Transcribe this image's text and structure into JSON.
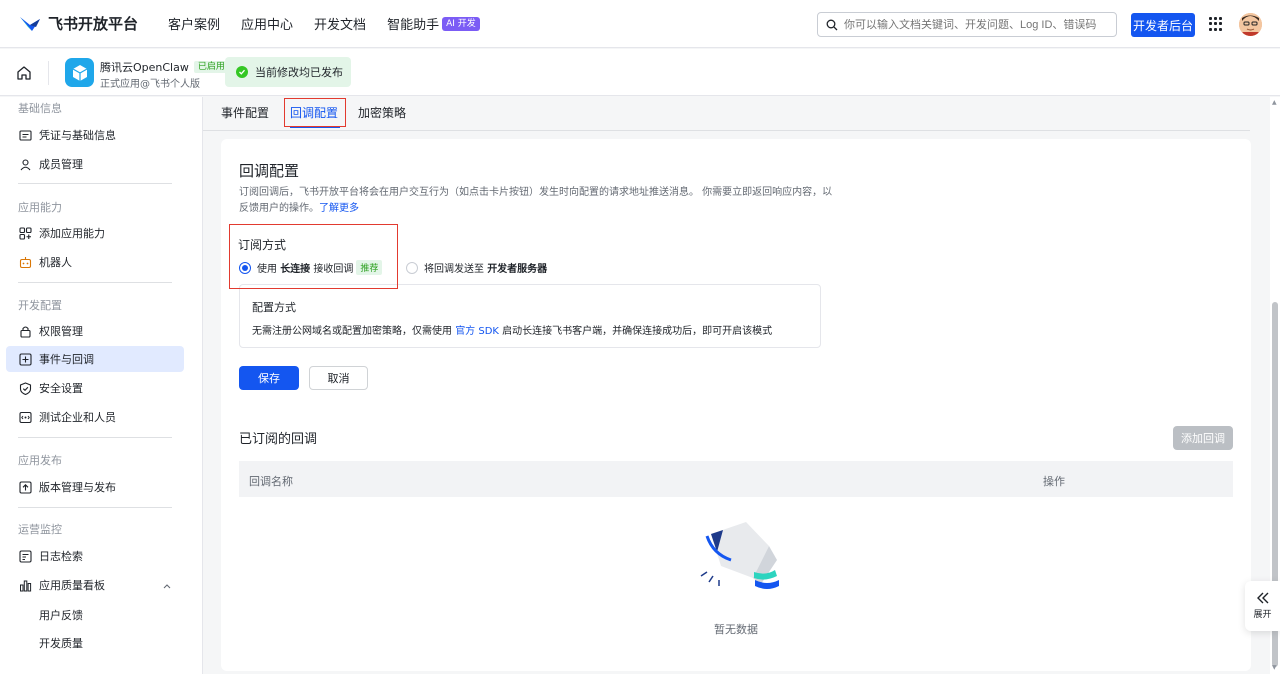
{
  "topnav": {
    "logo_text": "飞书开放平台",
    "links": [
      "客户案例",
      "应用中心",
      "开发文档",
      "智能助手"
    ],
    "ai_badge": "AI 开发",
    "search_placeholder": "你可以输入文档关键词、开发问题、Log ID、错误码",
    "dev_console": "开发者后台"
  },
  "appbar": {
    "app_name": "腾讯云OpenClaw",
    "app_status": "已启用",
    "app_sub": "正式应用@飞书个人版",
    "publish_status": "当前修改均已发布"
  },
  "sidebar": {
    "sections": [
      {
        "title": "基础信息",
        "items": [
          "凭证与基础信息",
          "成员管理"
        ]
      },
      {
        "title": "应用能力",
        "items": [
          "添加应用能力",
          "机器人"
        ]
      },
      {
        "title": "开发配置",
        "items": [
          "权限管理",
          "事件与回调",
          "安全设置",
          "测试企业和人员"
        ]
      },
      {
        "title": "应用发布",
        "items": [
          "版本管理与发布"
        ]
      },
      {
        "title": "运营监控",
        "items": [
          "日志检索",
          "应用质量看板"
        ],
        "sub_items": [
          "用户反馈",
          "开发质量"
        ]
      }
    ]
  },
  "tabs": [
    "事件配置",
    "回调配置",
    "加密策略"
  ],
  "card": {
    "title": "回调配置",
    "desc": "订阅回调后，飞书开放平台将会在用户交互行为（如点击卡片按钮）发生时向配置的请求地址推送消息。 你需要立即返回响应内容，以反馈用户的操作。",
    "learn_more": "了解更多",
    "subscribe_label": "订阅方式",
    "option1_pre": "使用",
    "option1_bold": "长连接",
    "option1_post": "接收回调",
    "option1_badge": "推荐",
    "option2_pre": "将回调发送至",
    "option2_bold": "开发者服务器",
    "cfg_title": "配置方式",
    "cfg_desc_pre": "无需注册公网域名或配置加密策略，仅需使用",
    "cfg_desc_link": "官方 SDK",
    "cfg_desc_post": "启动长连接飞书客户端，并确保连接成功后，即可开启该模式",
    "save": "保存",
    "cancel": "取消",
    "subscribed_title": "已订阅的回调",
    "add_callback": "添加回调",
    "col_name": "回调名称",
    "col_action": "操作",
    "empty": "暂无数据"
  },
  "expand_label": "展开",
  "colors": {
    "primary": "#1456f0",
    "success": "#34c724",
    "highlight": "#e23a2f"
  }
}
